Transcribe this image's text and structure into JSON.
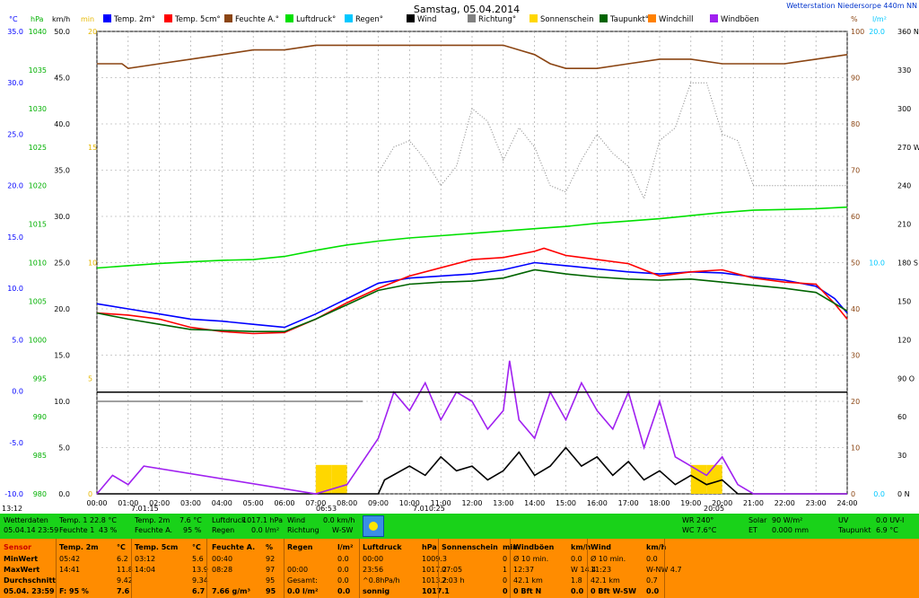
{
  "header": {
    "title": "Samstag, 05.04.2014",
    "station": "Wetterstation Niedersorpe 440m NN"
  },
  "legend": [
    {
      "label": "Temp. 2m°",
      "color": "#0000ff"
    },
    {
      "label": "Temp. 5cm°",
      "color": "#ff0000"
    },
    {
      "label": "Feuchte A.°",
      "color": "#8b4513"
    },
    {
      "label": "Luftdruck°",
      "color": "#00e000"
    },
    {
      "label": "Regen°",
      "color": "#00c8ff"
    },
    {
      "label": "Wind",
      "color": "#000000"
    },
    {
      "label": "Richtung°",
      "color": "#808080"
    },
    {
      "label": "Sonnenschein",
      "color": "#ffd700"
    },
    {
      "label": "Taupunkt°",
      "color": "#006400"
    },
    {
      "label": "Windchill",
      "color": "#ff8000"
    },
    {
      "label": "Windböen",
      "color": "#a020f0"
    }
  ],
  "chart_data": {
    "type": "line",
    "x_labels": [
      "00:00",
      "01:00",
      "02:00",
      "03:00",
      "04:00",
      "05:00",
      "06:00",
      "07:00",
      "08:00",
      "09:00",
      "10:00",
      "11:00",
      "12:00",
      "13:00",
      "14:00",
      "15:00",
      "16:00",
      "17:00",
      "18:00",
      "19:00",
      "20:00",
      "21:00",
      "22:00",
      "23:00",
      "24:00"
    ],
    "axes": {
      "temp_c": {
        "unit": "°C",
        "range": [
          -10,
          35
        ],
        "ticks": [
          "35.0",
          "30.0",
          "25.0",
          "20.0",
          "15.0",
          "10.0",
          "5.0",
          "0.0",
          "-5.0",
          "-10.0"
        ],
        "color": "#0000ff"
      },
      "pressure_hpa": {
        "unit": "hPa",
        "range": [
          980,
          1040
        ],
        "ticks": [
          "1040",
          "1035",
          "1030",
          "1025",
          "1020",
          "1015",
          "1010",
          "1005",
          "1000",
          "995",
          "990",
          "985",
          "980"
        ],
        "color": "#00b000"
      },
      "wind_kmh": {
        "unit": "km/h",
        "range": [
          0,
          50
        ],
        "ticks": [
          "50.0",
          "45.0",
          "40.0",
          "35.0",
          "30.0",
          "25.0",
          "20.0",
          "15.0",
          "10.0",
          "5.0",
          "0.0"
        ]
      },
      "sun_min": {
        "unit": "min",
        "range": [
          0,
          20
        ],
        "ticks": [
          "20",
          "15",
          "10",
          "5",
          "0"
        ],
        "color": "#e6b800"
      },
      "humidity_pct": {
        "unit": "%",
        "range": [
          0,
          100
        ],
        "ticks": [
          "100",
          "90",
          "80",
          "70",
          "60",
          "50",
          "40",
          "30",
          "20",
          "10",
          "0"
        ],
        "color": "#8b4513"
      },
      "rain_lm2": {
        "unit": "l/m²",
        "range": [
          0,
          20
        ],
        "ticks": [
          "20.0",
          "10.0",
          "0.0"
        ],
        "color": "#00c8ff"
      },
      "dir_deg": {
        "unit": "",
        "range": [
          0,
          360
        ],
        "ticks": [
          "360 N",
          "330",
          "300",
          "270 W",
          "240",
          "210",
          "180 S",
          "150",
          "120",
          "90 O",
          "60",
          "30",
          "0 N"
        ]
      }
    },
    "series": [
      {
        "name": "Temp. 2m°",
        "axis": "temp_c",
        "color": "#0000ff",
        "x": [
          0,
          1,
          2,
          3,
          4,
          5,
          6,
          7,
          8,
          9,
          10,
          11,
          12,
          13,
          14,
          15,
          16,
          17,
          18,
          19,
          20,
          21,
          22,
          23,
          23.6,
          24
        ],
        "y": [
          8.5,
          8.0,
          7.5,
          7.0,
          6.8,
          6.5,
          6.2,
          7.5,
          9.0,
          10.5,
          11.0,
          11.2,
          11.4,
          11.8,
          12.5,
          12.2,
          11.9,
          11.6,
          11.4,
          11.6,
          11.5,
          11.1,
          10.8,
          10.2,
          9.0,
          7.6
        ]
      },
      {
        "name": "Temp. 5cm°",
        "axis": "temp_c",
        "color": "#ff0000",
        "x": [
          0,
          1,
          2,
          3,
          4,
          5,
          6,
          7,
          8,
          9,
          10,
          11,
          12,
          13,
          14,
          14.3,
          15,
          16,
          17,
          18,
          19,
          20,
          21,
          22,
          23,
          23.6,
          24
        ],
        "y": [
          7.6,
          7.4,
          7.0,
          6.2,
          5.8,
          5.6,
          5.7,
          7.0,
          8.6,
          10.0,
          11.2,
          12.0,
          12.8,
          13.0,
          13.6,
          13.9,
          13.2,
          12.8,
          12.4,
          11.2,
          11.6,
          11.8,
          11.0,
          10.6,
          10.4,
          8.5,
          7.0
        ]
      },
      {
        "name": "Taupunkt°",
        "axis": "temp_c",
        "color": "#006400",
        "x": [
          0,
          1,
          2,
          3,
          4,
          5,
          6,
          7,
          8,
          9,
          10,
          11,
          12,
          13,
          14,
          15,
          16,
          17,
          18,
          19,
          20,
          21,
          22,
          23,
          24
        ],
        "y": [
          7.6,
          7.0,
          6.5,
          6.0,
          5.9,
          5.8,
          5.8,
          7.0,
          8.4,
          9.8,
          10.4,
          10.6,
          10.7,
          11.0,
          11.8,
          11.4,
          11.1,
          10.9,
          10.8,
          10.9,
          10.6,
          10.3,
          10.0,
          9.6,
          7.8
        ]
      },
      {
        "name": "Feuchte A.°",
        "axis": "humidity_pct",
        "color": "#8b4513",
        "x": [
          0,
          0.8,
          1,
          2,
          3,
          4,
          5,
          6,
          7,
          8,
          9,
          10,
          11,
          12,
          13,
          13.5,
          14,
          14.5,
          15,
          16,
          17,
          18,
          19,
          20,
          21,
          22,
          23,
          24
        ],
        "y": [
          93,
          93,
          92,
          93,
          94,
          95,
          96,
          96,
          97,
          97,
          97,
          97,
          97,
          97,
          97,
          96,
          95,
          93,
          92,
          92,
          93,
          94,
          94,
          93,
          93,
          93,
          94,
          95
        ]
      },
      {
        "name": "Luftdruck°",
        "axis": "pressure_hpa",
        "color": "#00e000",
        "x": [
          0,
          1,
          2,
          3,
          4,
          5,
          6,
          7,
          8,
          9,
          10,
          11,
          12,
          13,
          14,
          15,
          16,
          17,
          18,
          19,
          20,
          21,
          22,
          23,
          24
        ],
        "y": [
          1009.3,
          1009.6,
          1009.9,
          1010.1,
          1010.3,
          1010.4,
          1010.8,
          1011.6,
          1012.3,
          1012.8,
          1013.2,
          1013.5,
          1013.8,
          1014.1,
          1014.4,
          1014.7,
          1015.1,
          1015.4,
          1015.7,
          1016.1,
          1016.5,
          1016.8,
          1016.9,
          1017.0,
          1017.2
        ]
      },
      {
        "name": "Wind",
        "axis": "wind_kmh",
        "color": "#000000",
        "x": [
          0,
          9,
          9.2,
          10,
          10.5,
          11,
          11.5,
          12,
          12.5,
          13,
          13.5,
          14,
          14.5,
          15,
          15.5,
          16,
          16.5,
          17,
          17.5,
          18,
          18.5,
          19,
          19.5,
          20,
          20.5,
          24
        ],
        "y": [
          0,
          0,
          1.5,
          3.0,
          2.0,
          4.0,
          2.5,
          3.0,
          1.5,
          2.5,
          4.5,
          2.0,
          3.0,
          5.0,
          3.0,
          4.0,
          2.0,
          3.5,
          1.5,
          2.5,
          1.0,
          2.0,
          1.0,
          1.5,
          0,
          0
        ]
      },
      {
        "name": "Windböen",
        "axis": "wind_kmh",
        "color": "#a020f0",
        "x": [
          0,
          0.5,
          1,
          1.5,
          7,
          8,
          9,
          9.5,
          10,
          10.5,
          11,
          11.5,
          12,
          12.5,
          13,
          13.2,
          13.5,
          14,
          14.5,
          15,
          15.5,
          16,
          16.5,
          17,
          17.5,
          18,
          18.5,
          19,
          19.5,
          20,
          20.5,
          21,
          24
        ],
        "y": [
          0,
          2,
          1,
          3,
          0,
          1,
          6,
          11,
          9,
          12,
          8,
          11,
          10,
          7,
          9,
          14.4,
          8,
          6,
          11,
          8,
          12,
          9,
          7,
          11,
          5,
          10,
          4,
          3,
          2,
          4,
          1,
          0,
          0
        ]
      },
      {
        "name": "Richtung°",
        "axis": "dir_deg",
        "color": "#808080",
        "x": [
          0,
          8.5,
          9,
          9.5,
          10,
          10.5,
          11,
          11.5,
          12,
          12.5,
          13,
          13.5,
          14,
          14.5,
          15,
          15.5,
          16,
          16.5,
          17,
          17.5,
          18,
          18.5,
          19,
          19.5,
          20,
          20.5,
          21,
          22,
          23,
          24
        ],
        "y": [
          null,
          null,
          250,
          270,
          275,
          260,
          240,
          255,
          300,
          290,
          260,
          285,
          270,
          240,
          235,
          260,
          280,
          265,
          255,
          230,
          275,
          285,
          320,
          320,
          280,
          275,
          240,
          240,
          240,
          240
        ]
      }
    ],
    "bars": [
      {
        "name": "Sonnenschein",
        "axis": "sun_min",
        "color": "#ffd700",
        "x": [
          7.0,
          7.5,
          19.0,
          19.5
        ],
        "values": [
          1,
          1,
          1,
          1
        ]
      }
    ],
    "series_labels": {
      "wind_flat": "10.0",
      "wind_line": "11.0"
    },
    "markers": {
      "min_time": "7.01:15",
      "mid1": "06:53",
      "mid2": "7.010:25",
      "max_time": "20:05",
      "now": "13:12"
    }
  },
  "panel": {
    "row1": {
      "wetterdaten": "Wetterdaten",
      "date": "05.04.14 23:59",
      "temp1_label": "Temp. 1",
      "temp1_val": "22.8 °C",
      "feuchte1_label": "Feuchte 1",
      "feuchte1_val": "43 %",
      "temp2m_label": "Temp. 2m",
      "temp2m_val": "7.6 °C",
      "feuchteA_label": "Feuchte A.",
      "feuchteA_val": "95 %",
      "luftdruck_label": "Luftdruck",
      "luftdruck_val": "1017.1 hPa",
      "regen_label": "Regen",
      "regen_val": "0.0 l/m²",
      "wind_label": "Wind",
      "wind_val": "0.0 km/h",
      "richtung_label": "Richtung",
      "richtung_val": "W-SW",
      "wr": "WR 240°",
      "wc": "WC 7.6°C",
      "solar_label": "Solar",
      "solar_val": "90 W/m²",
      "et_label": "ET",
      "et_val": "0.000 mm",
      "uv_label": "UV",
      "uv_val": "0.0 UV-I",
      "taupunkt_label": "Taupunkt",
      "taupunkt_val": "6.9 °C"
    },
    "table": {
      "headers": [
        "Sensor",
        "Temp. 2m",
        "°C",
        "Temp. 5cm",
        "°C",
        "Feuchte A.",
        "%",
        "Regen",
        "l/m²",
        "Luftdruck",
        "hPa",
        "Sonnenschein",
        "min",
        "Windböen",
        "km/h",
        "Wind",
        "km/h"
      ],
      "rows": [
        {
          "label": "MinWert",
          "c": [
            "05:42",
            "6.2",
            "03:12",
            "5.6",
            "00:40",
            "92",
            "",
            "0.0",
            "00:00",
            "1009.3",
            "",
            "0",
            "Ø 10 min.",
            "0.0",
            "Ø 10 min.",
            "0.0"
          ]
        },
        {
          "label": "MaxWert",
          "c": [
            "14:41",
            "11.8",
            "14:04",
            "13.9",
            "08:28",
            "97",
            "00:00",
            "0.0",
            "23:56",
            "1017.2",
            "07:05",
            "1",
            "12:37",
            "W 14.4",
            "11:23",
            "W-NW 4.7"
          ]
        },
        {
          "label": "Durchschnitt",
          "c": [
            "",
            "9.42",
            "",
            "9.34",
            "",
            "95",
            "Gesamt:",
            "0.0",
            "^0.8hPa/h",
            "1013.2",
            "2:03 h",
            "0",
            "42.1 km",
            "1.8",
            "42.1 km",
            "0.7"
          ]
        },
        {
          "label": "05.04. 23:59",
          "c": [
            "F: 95 %",
            "7.6",
            "",
            "6.7",
            "7.66 g/m³",
            "95",
            "0.0 l/m²",
            "0.0",
            "sonnig",
            "1017.1",
            "",
            "0",
            "0 Bft N",
            "0.0",
            "0 Bft W-SW",
            "0.0"
          ]
        }
      ]
    }
  }
}
